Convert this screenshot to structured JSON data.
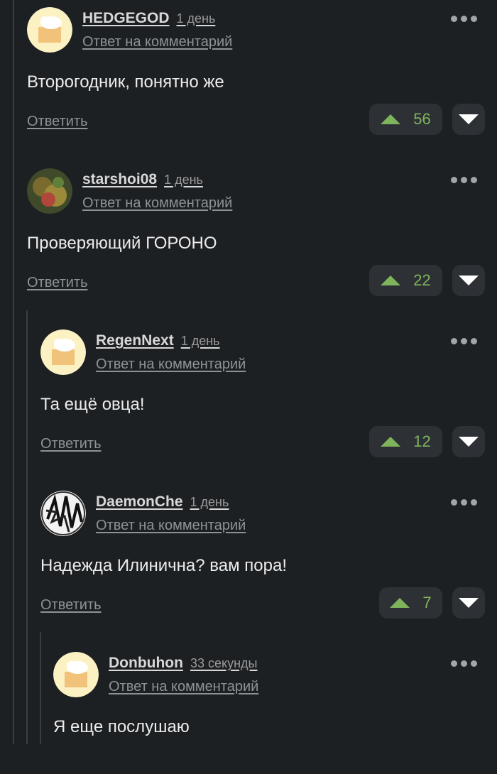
{
  "comments": [
    {
      "username": "HEDGEGOD",
      "time": "1 день",
      "reply_to": "Ответ на комментарий",
      "text": "Второгодник, понятно же",
      "answer": "Ответить",
      "rating": "56"
    },
    {
      "username": "starshoi08",
      "time": "1 день",
      "reply_to": "Ответ на комментарий",
      "text": "Проверяющий ГОРОНО",
      "answer": "Ответить",
      "rating": "22"
    },
    {
      "username": "RegenNext",
      "time": "1 день",
      "reply_to": "Ответ на комментарий",
      "text": "Та ещё овца!",
      "answer": "Ответить",
      "rating": "12"
    },
    {
      "username": "DaemonChe",
      "time": "1 день",
      "reply_to": "Ответ на комментарий",
      "text": "Надежда Илинична? вам пора!",
      "answer": "Ответить",
      "rating": "7"
    },
    {
      "username": "Donbuhon",
      "time": "33 секунды",
      "reply_to": "Ответ на комментарий",
      "text": "Я еще послушаю"
    }
  ],
  "colors": {
    "background": "#1d2023",
    "upvote": "#7eb55c",
    "button_bg": "#2d3135"
  }
}
